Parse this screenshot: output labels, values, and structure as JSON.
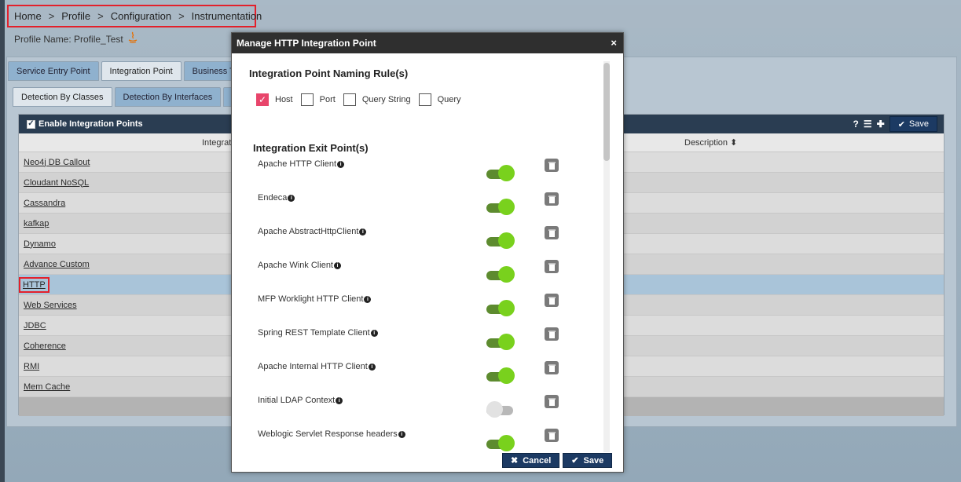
{
  "breadcrumb": {
    "items": [
      "Home",
      "Profile",
      "Configuration",
      "Instrumentation"
    ],
    "separator": ">"
  },
  "profile": {
    "label": "Profile Name: Profile_Test"
  },
  "tabs_row1": [
    "Service Entry Point",
    "Integration Point",
    "Business T"
  ],
  "tabs_row2": [
    "Detection By Classes",
    "Detection By Interfaces"
  ],
  "grid": {
    "enable_label": "Enable Integration Points",
    "save_label": "Save",
    "columns": [
      "Integrat",
      "Description"
    ],
    "rows": [
      "Neo4j DB Callout",
      "Cloudant NoSQL",
      "Cassandra",
      "kafkap",
      "Dynamo",
      "Advance Custom",
      "HTTP",
      "Web Services",
      "JDBC",
      "Coherence",
      "RMI",
      "Mem Cache"
    ],
    "selected_row": "HTTP"
  },
  "modal": {
    "title": "Manage HTTP Integration Point",
    "naming_title": "Integration Point Naming Rule(s)",
    "rules": [
      {
        "label": "Host",
        "checked": true
      },
      {
        "label": "Port",
        "checked": false
      },
      {
        "label": "Query String",
        "checked": false
      },
      {
        "label": "Query",
        "checked": false
      }
    ],
    "exit_title": "Integration Exit Point(s)",
    "exit_points": [
      {
        "label": "Apache HTTP Client",
        "enabled": true
      },
      {
        "label": "Endeca",
        "enabled": true
      },
      {
        "label": "Apache AbstractHttpClient",
        "enabled": true
      },
      {
        "label": "Apache Wink Client",
        "enabled": true
      },
      {
        "label": "MFP Worklight HTTP Client",
        "enabled": true
      },
      {
        "label": "Spring REST Template Client",
        "enabled": true
      },
      {
        "label": "Apache Internal HTTP Client",
        "enabled": true
      },
      {
        "label": "Initial LDAP Context",
        "enabled": false
      },
      {
        "label": "Weblogic Servlet Response headers",
        "enabled": true
      }
    ],
    "cancel_label": "Cancel",
    "save_label": "Save"
  },
  "colors": {
    "accent_pink": "#e8456b",
    "toggle_on": "#79d11d",
    "button_navy": "#1c3a63",
    "highlight_red": "#e3202b"
  }
}
